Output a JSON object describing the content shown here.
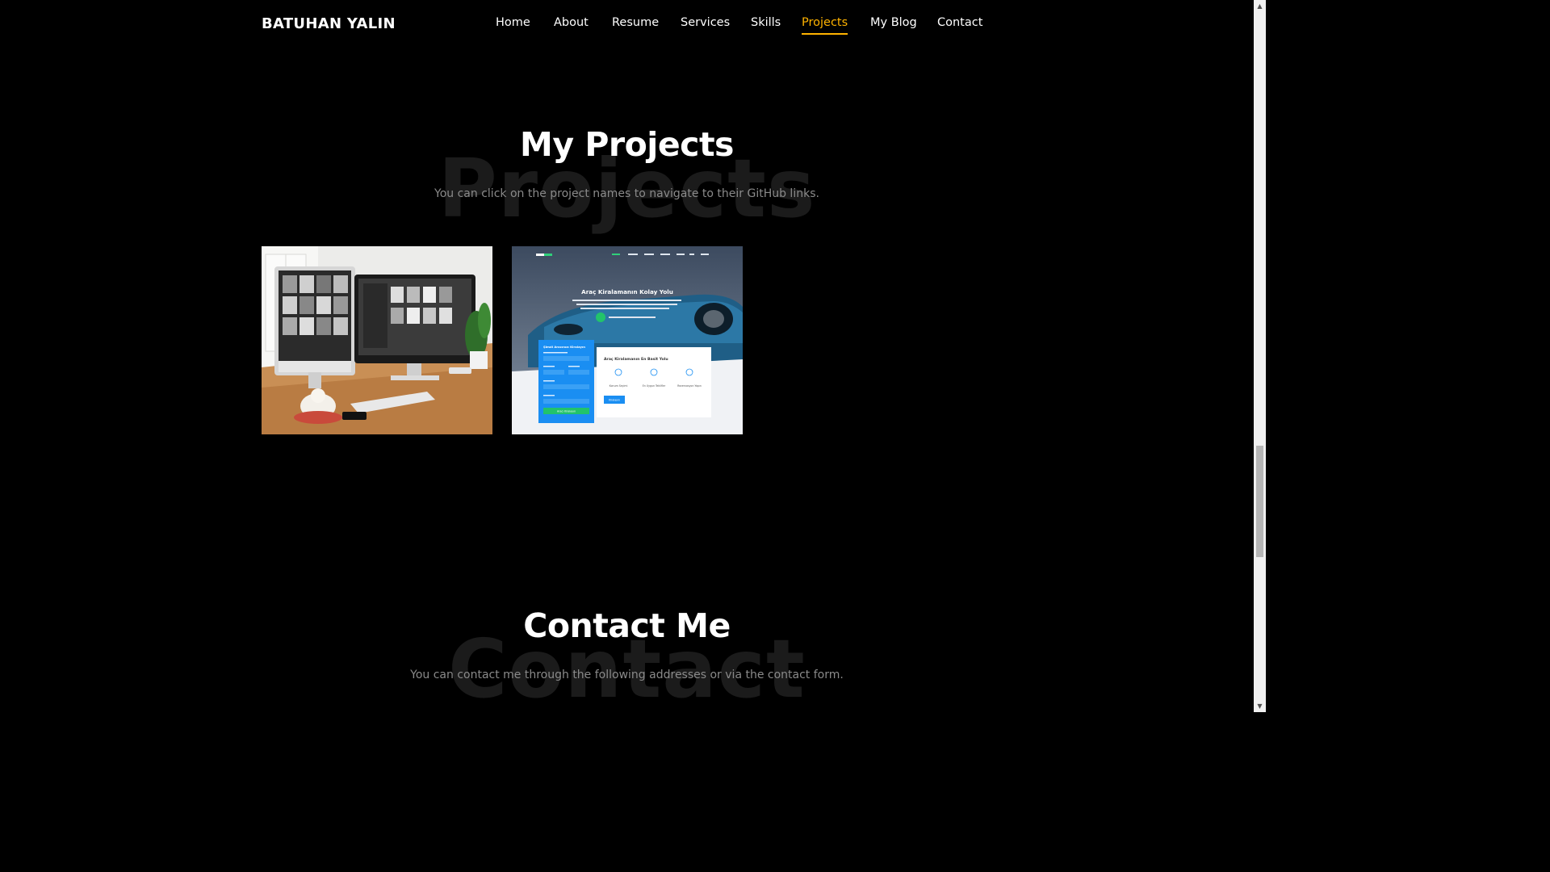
{
  "header": {
    "logo": "BATUHAN YALIN",
    "nav": [
      {
        "label": "Home",
        "active": false
      },
      {
        "label": "About",
        "active": false
      },
      {
        "label": "Resume",
        "active": false
      },
      {
        "label": "Services",
        "active": false
      },
      {
        "label": "Skills",
        "active": false
      },
      {
        "label": "Projects",
        "active": true
      },
      {
        "label": "My Blog",
        "active": false
      },
      {
        "label": "Contact",
        "active": false
      }
    ]
  },
  "projects": {
    "title": "My Projects",
    "bg_word": "Projects",
    "subtitle": "You can click on the project names to navigate to their GitHub links.",
    "cards": [
      {
        "image": "desk-workspace-image"
      },
      {
        "image": "car-rental-site-preview",
        "preview": {
          "hero_title": "Araç Kiralamanın Kolay Yolu",
          "form_title": "Şimdi Aracınızı Kiralayın",
          "form_button": "Aracı Kiralayın",
          "card_title": "Araç Kiralamanın En Basit Yolu",
          "card_items": [
            "Konum Seçimi",
            "En Uygun Teklifler",
            "Rezervasyon Yapın"
          ],
          "card_button": "Kiralayın"
        }
      }
    ]
  },
  "contact": {
    "title": "Contact Me",
    "bg_word": "Contact",
    "subtitle": "You can contact me through the following addresses or via the contact form."
  },
  "colors": {
    "accent": "#ffb300",
    "background": "#000000",
    "watermark": "#1b1b1b"
  }
}
